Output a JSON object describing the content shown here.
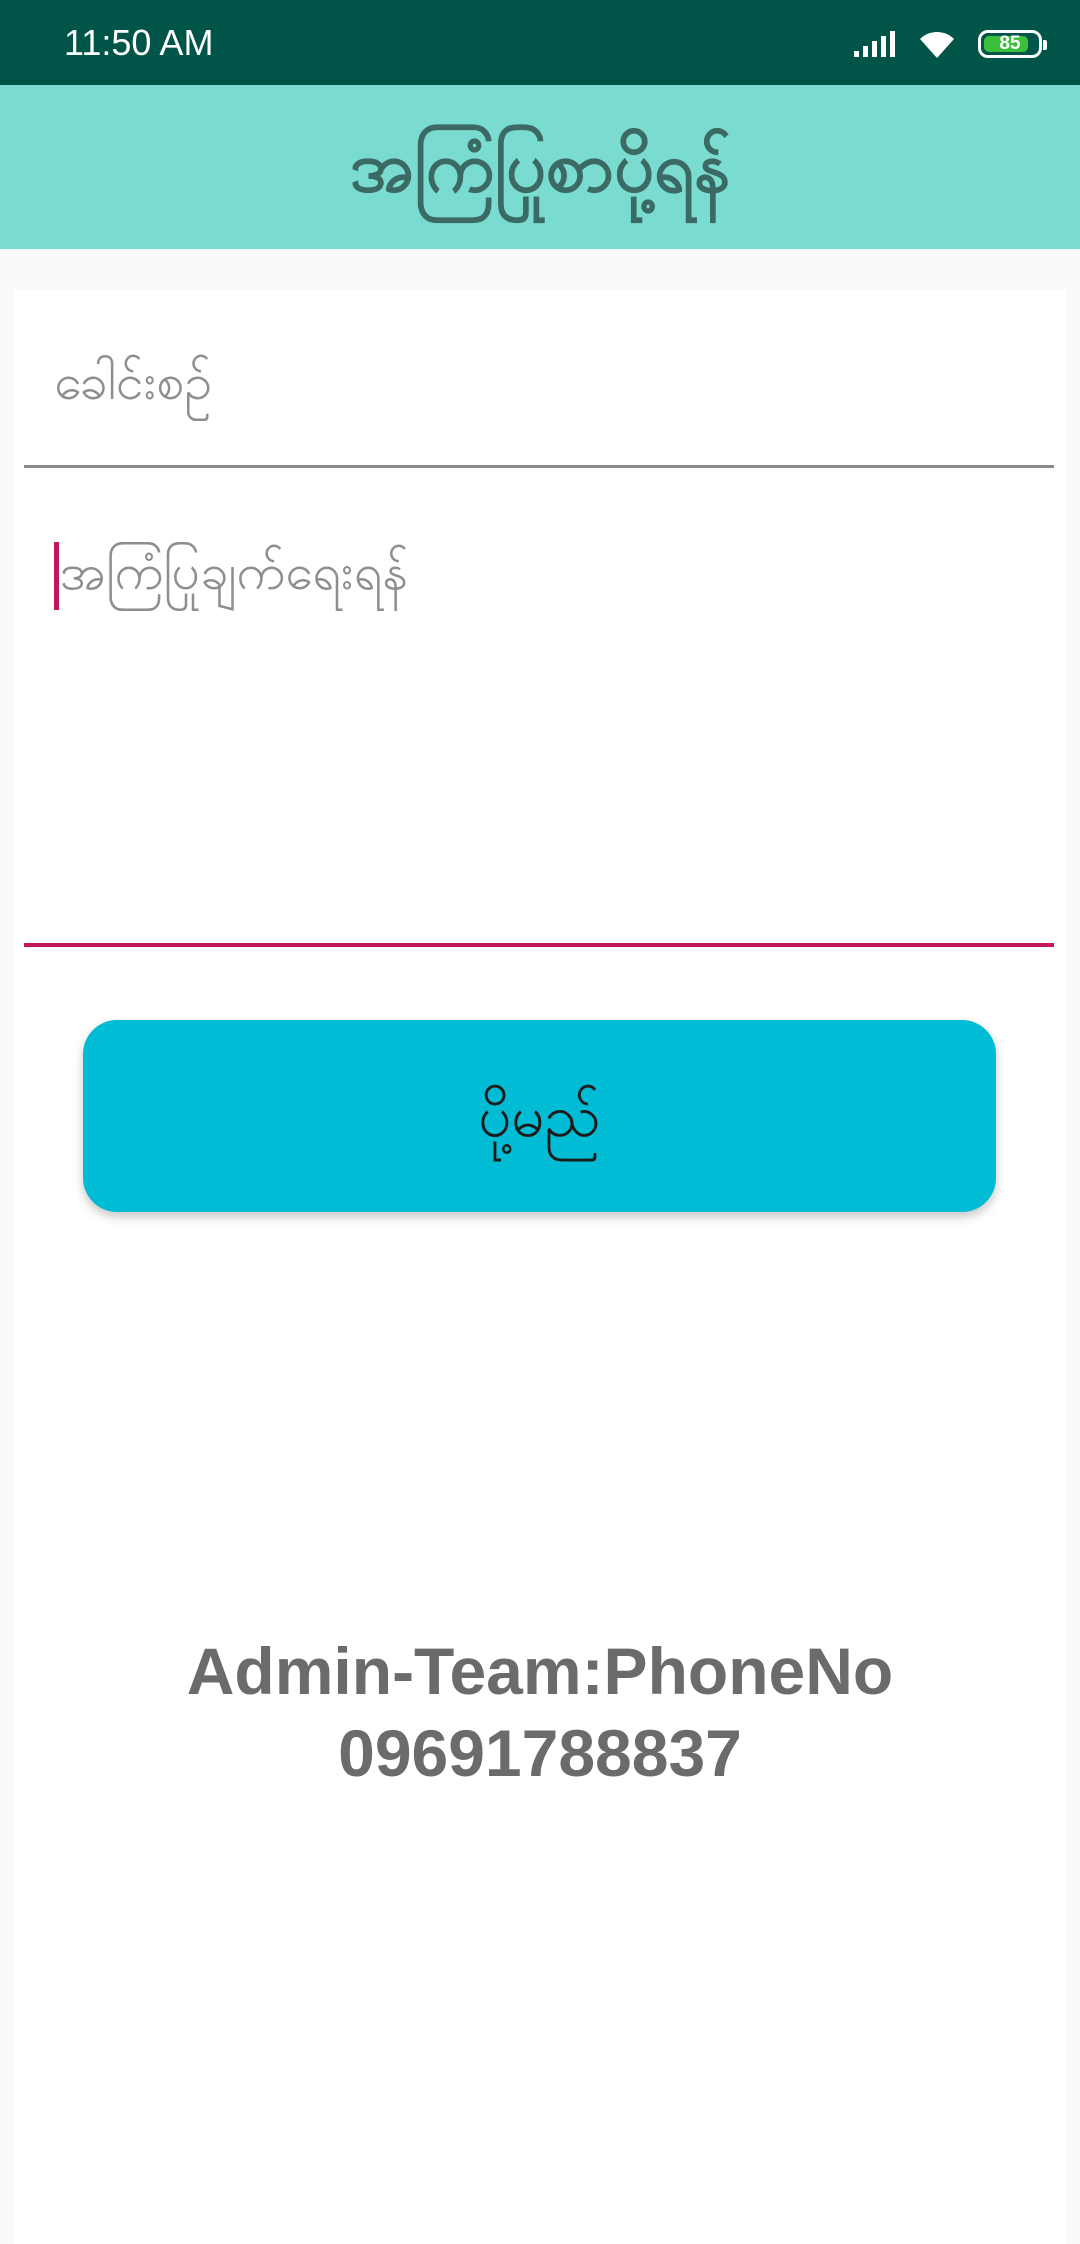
{
  "status_bar": {
    "time": "11:50 AM",
    "battery_level": "85",
    "battery_fraction": 0.85,
    "icons": [
      "signal-icon",
      "wifi-icon",
      "battery-icon"
    ]
  },
  "app_bar": {
    "title": "အကြံပြုစာပို့ရန်"
  },
  "form": {
    "title_placeholder": "ခေါင်းစဉ်",
    "body_placeholder": "အကြံပြုချက်ရေးရန်",
    "send_label": "ပို့မည်"
  },
  "footer": {
    "line1": "Admin-Team:PhoneNo",
    "line2": "09691788837"
  },
  "colors": {
    "status_bar": "#005548",
    "app_bar": "#7adcd0",
    "accent": "#c2185b",
    "button": "#00bcd4"
  }
}
